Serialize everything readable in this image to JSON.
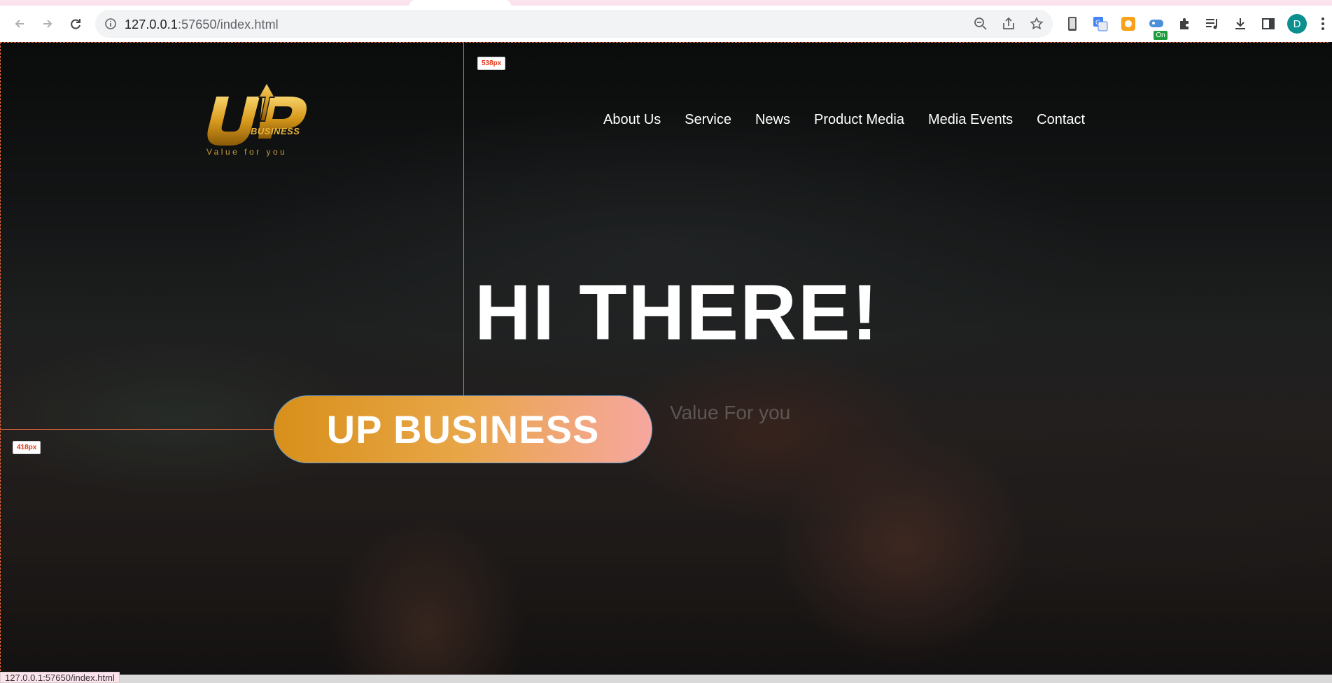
{
  "browser": {
    "url_host": "127.0.0.1",
    "url_rest": ":57650/index.html",
    "profile_initial": "D",
    "extension_badge": "On",
    "status_url": "127.0.0.1:57650/index.html"
  },
  "site": {
    "logo": {
      "word": "BUSINESS",
      "tagline": "Value for you"
    },
    "nav": [
      "About Us",
      "Service",
      "News",
      "Product Media",
      "Media Events",
      "Contact"
    ],
    "hero": {
      "title": "HI THERE!",
      "subtitle": "Value For you",
      "cta_label": "UP BUSINESS"
    }
  },
  "devtools_overlay": {
    "vertical_label": "538px",
    "horizontal_label": "418px",
    "color": "#f26a3b"
  }
}
